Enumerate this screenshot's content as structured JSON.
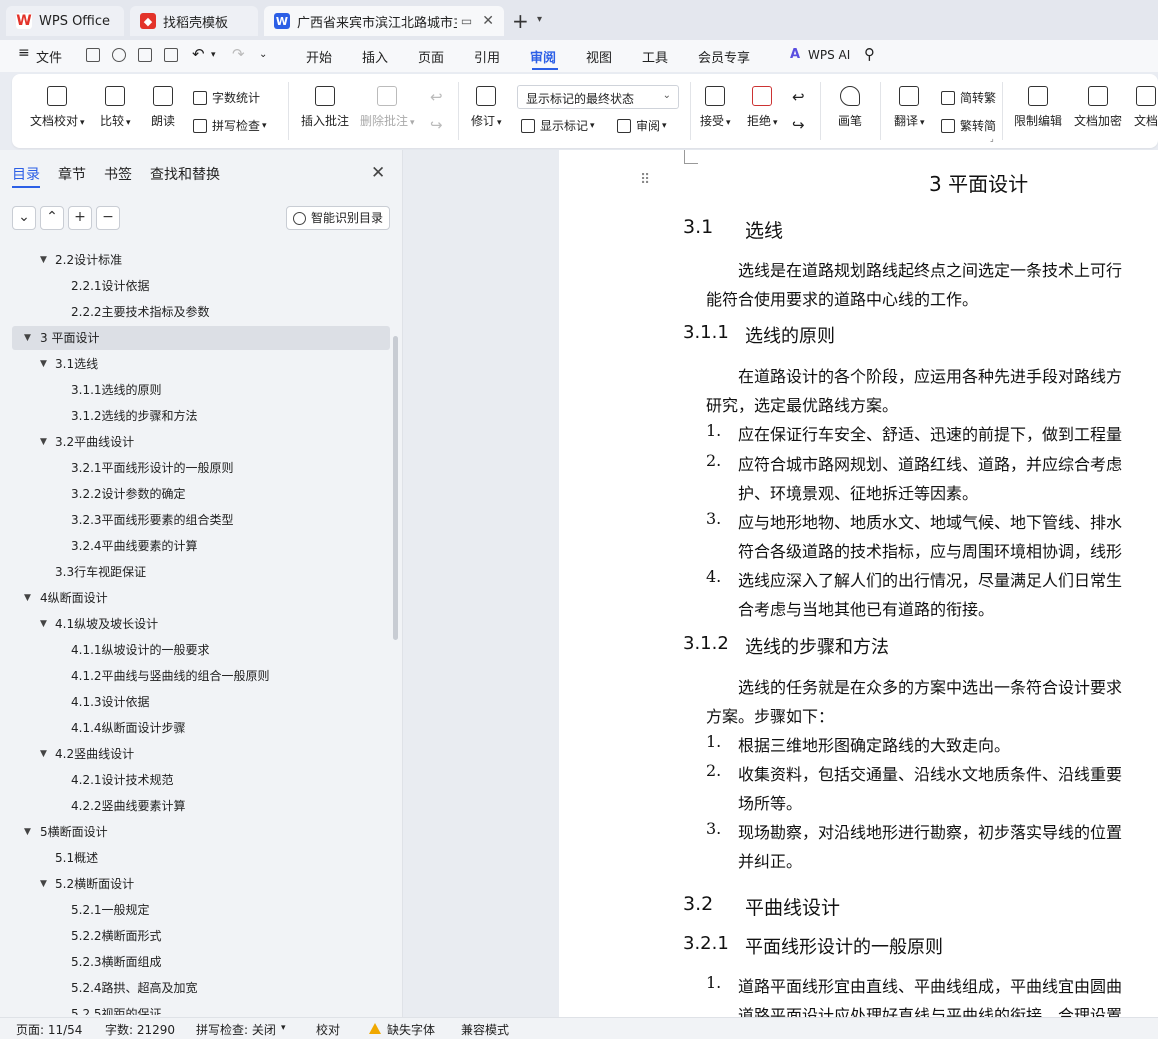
{
  "tabs": [
    {
      "label": "WPS Office",
      "icon": "wps-logo-icon",
      "color": "#e3332a"
    },
    {
      "label": "找稻壳模板",
      "icon": "docer-icon",
      "color": "#e3332a"
    },
    {
      "label": "广西省来宾市滨江北路城市主干",
      "icon": "word-doc-icon",
      "color": "#2c5fe6"
    }
  ],
  "menubar": {
    "file": "文件",
    "items": [
      "开始",
      "插入",
      "页面",
      "引用",
      "审阅",
      "视图",
      "工具",
      "会员专享"
    ],
    "active": "审阅",
    "wps_ai": "WPS AI",
    "accent": "#2c5fe6"
  },
  "ribbon": {
    "doc_check": "文档校对",
    "compare": "比较",
    "read_aloud": "朗读",
    "word_count": "字数统计",
    "spell_check": "拼写检查",
    "insert_comment": "插入批注",
    "delete_comment": "删除批注",
    "revise": "修订",
    "markup_state": "显示标记的最终状态",
    "show_markup": "显示标记",
    "review": "审阅",
    "accept": "接受",
    "reject": "拒绝",
    "pen": "画笔",
    "translate": "翻译",
    "to_traditional": "简转繁",
    "to_simplified": "繁转简",
    "restrict_edit": "限制编辑",
    "doc_encrypt": "文档加密",
    "doc_more": "文档"
  },
  "nav": {
    "tabs": [
      "目录",
      "章节",
      "书签",
      "查找和替换"
    ],
    "active_tab": "目录",
    "smart_toc": "智能识别目录",
    "toc": [
      {
        "text": "2.2设计标准",
        "level": 2,
        "arrow": true
      },
      {
        "text": "2.2.1设计依据",
        "level": 3
      },
      {
        "text": "2.2.2主要技术指标及参数",
        "level": 3
      },
      {
        "text": "3   平面设计",
        "level": 1,
        "arrow": true,
        "selected": true
      },
      {
        "text": "3.1选线",
        "level": 2,
        "arrow": true
      },
      {
        "text": "3.1.1选线的原则",
        "level": 3
      },
      {
        "text": "3.1.2选线的步骤和方法",
        "level": 3
      },
      {
        "text": "3.2平曲线设计",
        "level": 2,
        "arrow": true
      },
      {
        "text": "3.2.1平面线形设计的一般原则",
        "level": 3
      },
      {
        "text": "3.2.2设计参数的确定",
        "level": 3
      },
      {
        "text": "3.2.3平面线形要素的组合类型",
        "level": 3
      },
      {
        "text": "3.2.4平曲线要素的计算",
        "level": 3
      },
      {
        "text": "3.3行车视距保证",
        "level": 2
      },
      {
        "text": "4纵断面设计",
        "level": 1,
        "arrow": true
      },
      {
        "text": "4.1纵坡及坡长设计",
        "level": 2,
        "arrow": true
      },
      {
        "text": "4.1.1纵坡设计的一般要求",
        "level": 3
      },
      {
        "text": "4.1.2平曲线与竖曲线的组合一般原则",
        "level": 3
      },
      {
        "text": "4.1.3设计依据",
        "level": 3
      },
      {
        "text": "4.1.4纵断面设计步骤",
        "level": 3
      },
      {
        "text": "4.2竖曲线设计",
        "level": 2,
        "arrow": true
      },
      {
        "text": "4.2.1设计技术规范",
        "level": 3
      },
      {
        "text": "4.2.2竖曲线要素计算",
        "level": 3
      },
      {
        "text": "5横断面设计",
        "level": 1,
        "arrow": true
      },
      {
        "text": "5.1概述",
        "level": 2
      },
      {
        "text": "5.2横断面设计",
        "level": 2,
        "arrow": true
      },
      {
        "text": "5.2.1一般规定",
        "level": 3
      },
      {
        "text": "5.2.2横断面形式",
        "level": 3
      },
      {
        "text": "5.2.3横断面组成",
        "level": 3
      },
      {
        "text": "5.2.4路拱、超高及加宽",
        "level": 3
      },
      {
        "text": "5.2.5视距的保证",
        "level": 3
      }
    ]
  },
  "document": {
    "chapter_title": "3   平面设计",
    "s31": {
      "num": "3.1",
      "title": "选线"
    },
    "s31_p1": "选线是在道路规划路线起终点之间选定一条技术上可行",
    "s31_p2": "能符合使用要求的道路中心线的工作。",
    "s311": {
      "num": "3.1.1",
      "title": "选线的原则"
    },
    "s311_p1": "在道路设计的各个阶段，应运用各种先进手段对路线方",
    "s311_p2": "研究，选定最优路线方案。",
    "s311_items": [
      {
        "n": "1.",
        "l1": "应在保证行车安全、舒适、迅速的前提下，做到工程量",
        "l2": ""
      },
      {
        "n": "2.",
        "l1": "应符合城市路网规划、道路红线、道路，并应综合考虑",
        "l2": "护、环境景观、征地拆迁等因素。"
      },
      {
        "n": "3.",
        "l1": "应与地形地物、地质水文、地域气候、地下管线、排水",
        "l2": "符合各级道路的技术指标，应与周围环境相协调，线形"
      },
      {
        "n": "4.",
        "l1": "选线应深入了解人们的出行情况，尽量满足人们日常生",
        "l2": "合考虑与当地其他已有道路的衔接。"
      }
    ],
    "s312": {
      "num": "3.1.2",
      "title": "选线的步骤和方法"
    },
    "s312_p1": "选线的任务就是在众多的方案中选出一条符合设计要求",
    "s312_p2": "方案。步骤如下：",
    "s312_items": [
      {
        "n": "1.",
        "l1": "根据三维地形图确定路线的大致走向。",
        "l2": ""
      },
      {
        "n": "2.",
        "l1": "收集资料，包括交通量、沿线水文地质条件、沿线重要",
        "l2": "场所等。"
      },
      {
        "n": "3.",
        "l1": "现场勘察，对沿线地形进行勘察，初步落实导线的位置",
        "l2": "并纠正。"
      }
    ],
    "s32": {
      "num": "3.2",
      "title": "平曲线设计"
    },
    "s321": {
      "num": "3.2.1",
      "title": "平面线形设计的一般原则"
    },
    "s321_items": [
      {
        "n": "1.",
        "l1": "道路平面线形宜由直线、平曲线组成，平曲线宜由圆曲",
        "l2": "道路平面设计应处理好直线与平曲线的衔接，合理设置"
      }
    ]
  },
  "statusbar": {
    "page": "页面: 11/54",
    "words": "字数: 21290",
    "spell": "拼写检查: 关闭",
    "proof": "校对",
    "missing_font": "缺失字体",
    "compat": "兼容模式"
  }
}
